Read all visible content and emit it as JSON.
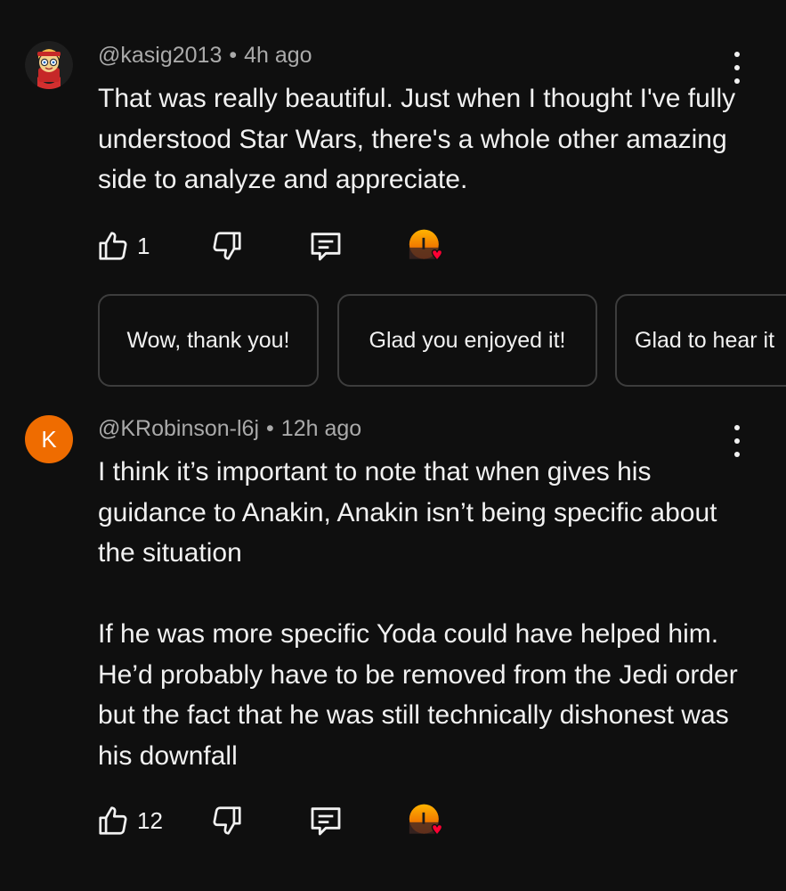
{
  "comments": [
    {
      "author": "@kasig2013",
      "separator": "•",
      "time": "4h ago",
      "paragraphs": [
        "That was really beautiful. Just when I thought I've fully understood Star Wars, there's a whole other amazing side to analyze and appreciate."
      ],
      "likes": "1"
    },
    {
      "avatar_letter": "K",
      "author": "@KRobinson-l6j",
      "separator": "•",
      "time": "12h ago",
      "paragraphs": [
        "I think it’s important to note that when gives his guidance to Anakin, Anakin isn’t being specific about the situation",
        "If he was more specific Yoda could have helped him. He’d probably have to be removed from the Jedi order but the fact that he was still technically dishonest was his downfall"
      ],
      "likes": "12"
    }
  ],
  "suggested_replies": [
    "Wow, thank you!",
    "Glad you enjoyed it!",
    "Glad to hear it"
  ],
  "icons": {
    "like": "thumbs-up-icon",
    "dislike": "thumbs-down-icon",
    "reply": "reply-icon",
    "creator_heart": "creator-heart-icon",
    "more": "more-vert-icon"
  },
  "colors": {
    "background": "#0f0f0f",
    "text": "#f1f1f1",
    "meta": "#aaaaaa",
    "avatar_k": "#ef6c00",
    "heart": "#ff0033"
  }
}
